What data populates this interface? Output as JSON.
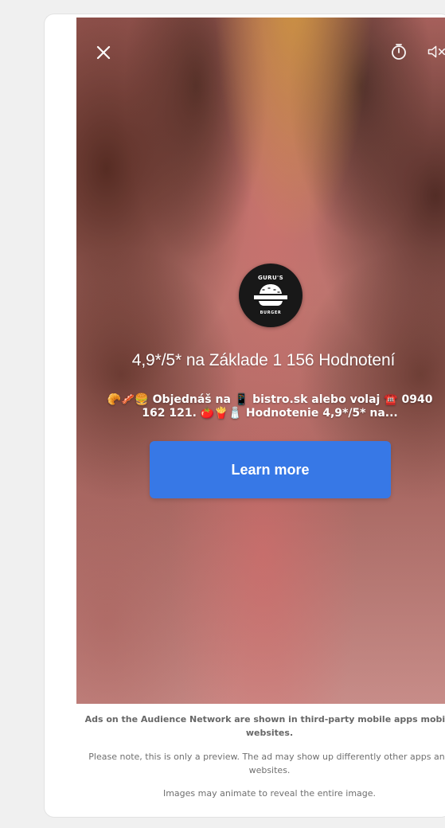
{
  "preview": {
    "ad": {
      "logo": {
        "wordmark": "GURU'S",
        "subword": "BURGER"
      },
      "title": "4,9*/5* na Základe 1 156 Hodnotení",
      "body_line1": "🥐🥓🍔 Objednáš na 📱 bistro.sk alebo volaj ☎️ 0940",
      "body_line2": "162 121. 🍅🍟🧂 Hodnotenie 4,9*/5* na...",
      "cta_label": "Learn more",
      "icons": {
        "close": "close-icon",
        "timer": "timer-icon",
        "sound": "speaker-muted-icon"
      },
      "colors": {
        "cta": "#3778e6",
        "title": "#ffffff",
        "logo_background": "#181818"
      }
    },
    "footer": {
      "audience_network_note": "Ads on the Audience Network are shown in third-party mobile apps mobile websites.",
      "preview_note": "Please note, this is only a preview. The ad may show up differently other apps and websites.",
      "animation_note": "Images may animate to reveal the entire image."
    }
  }
}
